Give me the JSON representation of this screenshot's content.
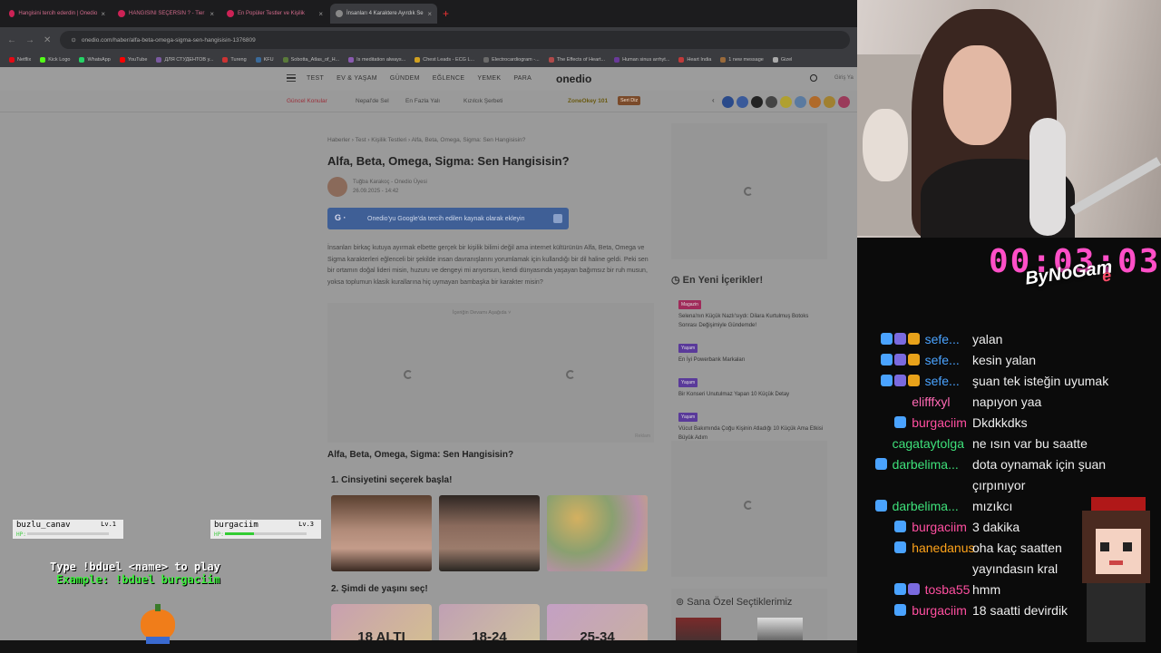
{
  "browser": {
    "tabs": [
      {
        "label": "Hangisini tercih ederdin | Onedio",
        "active": false
      },
      {
        "label": "HANGISINI SEÇERSIN ? - Tier",
        "active": false
      },
      {
        "label": "En Popüler Testler ve Kişilik",
        "active": false
      },
      {
        "label": "İnsanları 4 Karaktere Ayırdık Se",
        "active": true
      }
    ],
    "url": "onedio.com/haber/alfa-beta-omega-sigma-sen-hangisisin-1376809",
    "bookmarks": [
      "Netflix",
      "Kick Logo",
      "WhatsApp",
      "YouTube",
      "ДЛЯ СТУДЕНТОВ у...",
      "Tureng",
      "KFU",
      "Sobotta_Atlas_of_H...",
      "Is meditation always...",
      "Chest Leads - ECG L...",
      "Electrocardiogram -...",
      "The Effects of Heart...",
      "Human sinus arrhyt...",
      "Heart India",
      "1 new message",
      "Gizel"
    ]
  },
  "site": {
    "nav": [
      "TEST",
      "EV & YAŞAM",
      "GÜNDEM",
      "EĞLENCE",
      "YEMEK",
      "PARA"
    ],
    "logo": "onedio",
    "login": "Giriş Ya",
    "hot_label": "Güncel Konular",
    "sub_links": [
      "Nepal'de Sel",
      "En Fazla Yalı",
      "Kızılcık Şerbeti"
    ],
    "zone": "ZoneOkey 101",
    "seri": "Seri Diz",
    "breadcrumb": "Haberler › Test › Kişilik Testleri › Alfa, Beta, Omega, Sigma: Sen Hangisisin?",
    "title": "Alfa, Beta, Omega, Sigma: Sen Hangisisin?",
    "author": "Tuğba Karakoç - Onedio Üyesi",
    "date": "26.09.2025 - 14:42",
    "google_btn": "Onedio'yu Google'da tercih edilen kaynak olarak ekleyin",
    "intro": "İnsanları birkaç kutuya ayırmak elbette gerçek bir kişilik bilimi değil ama internet kültürünün Alfa, Beta, Omega ve Sigma karakterleri eğlenceli bir şekilde insan davranışlarını yorumlamak için kullandığı bir dil haline geldi. Peki sen bir ortamın doğal lideri misin, huzuru ve dengeyi mi arıyorsun, kendi dünyasında yaşayan bağımsız bir ruh musun, yoksa toplumun klasik kurallarına hiç uymayan bambaşka bir karakter misin?",
    "ad_label": "İçeriğin Devamı Aşağıda ˅",
    "ad_tag": "Reklam",
    "quiz_title": "Alfa, Beta, Omega, Sigma: Sen Hangisisin?",
    "q1": "1. Cinsiyetini seçerek başla!",
    "q2": "2. Şimdi de yaşını seç!",
    "ages": [
      "18 ALTI",
      "18-24",
      "25-34"
    ],
    "new_head": "En Yeni İçerikler!",
    "new_items": [
      {
        "tag": "Magazin",
        "text": "Selena'nın Küçük Nazlı'sıydı: Dilara Kurtulmuş Botoks Sonrası Değişimiyle Gündemde!"
      },
      {
        "tag": "Yaşam",
        "text": "En İyi Powerbank Markaları"
      },
      {
        "tag": "Yaşam",
        "text": "Bir Konseri Unutulmaz Yapan 10 Küçük Detay"
      },
      {
        "tag": "Yaşam",
        "text": "Vücut Bakımında Çoğu Kişinin Atladığı 10 Küçük Ama Etkisi Büyük Adım"
      }
    ],
    "special_head": "Sana Özel Seçtiklerimiz"
  },
  "stream": {
    "timer": "00:03:03",
    "brand": "ByNoGam",
    "brand_end": "e",
    "chat": [
      {
        "user": "sefe...",
        "color": "#4aa3ff",
        "msg": "yalan",
        "badges": 3
      },
      {
        "user": "sefe...",
        "color": "#4aa3ff",
        "msg": "kesin yalan",
        "badges": 3
      },
      {
        "user": "sefe...",
        "color": "#4aa3ff",
        "msg": "şuan tek isteğin uyumak",
        "badges": 3
      },
      {
        "user": "elifffxyl",
        "color": "#ff69b4",
        "msg": "napıyon yaa",
        "badges": 0
      },
      {
        "user": "burgaciim",
        "color": "#ff4fa0",
        "msg": "Dkdkkdks",
        "badges": 1
      },
      {
        "user": "cagataytolga",
        "color": "#3ee07a",
        "msg": "ne ısın var bu saatte",
        "badges": 0
      },
      {
        "user": "darbelima...",
        "color": "#3ee07a",
        "msg": "dota oynamak için şuan",
        "badges": 1
      },
      {
        "user": "",
        "color": "#3ee07a",
        "msg": "çırpınıyor",
        "badges": 0
      },
      {
        "user": "darbelima...",
        "color": "#3ee07a",
        "msg": "mızıkcı",
        "badges": 1
      },
      {
        "user": "burgaciim",
        "color": "#ff4fa0",
        "msg": "3 dakika",
        "badges": 1
      },
      {
        "user": "hanedanus",
        "color": "#ffa31a",
        "msg": "oha kaç saatten",
        "badges": 1
      },
      {
        "user": "",
        "color": "#ffa31a",
        "msg": "yayındasın kral",
        "badges": 0
      },
      {
        "user": "tosba55",
        "color": "#ff4fa0",
        "msg": "hmm",
        "badges": 2
      },
      {
        "user": "burgaciim",
        "color": "#ff4fa0",
        "msg": "18 saatti devirdik",
        "badges": 1
      }
    ],
    "game": {
      "player1": "buzlu_canav",
      "player1_lv": "Lv.1",
      "player2": "burgaciim",
      "player2_lv": "Lv.3",
      "hp_label": "HP:",
      "player1_hp": 0.0,
      "player2_hp": 0.35,
      "instruction": "Type !bduel <name> to play",
      "example": "Example: !bduel burgaciim"
    }
  }
}
